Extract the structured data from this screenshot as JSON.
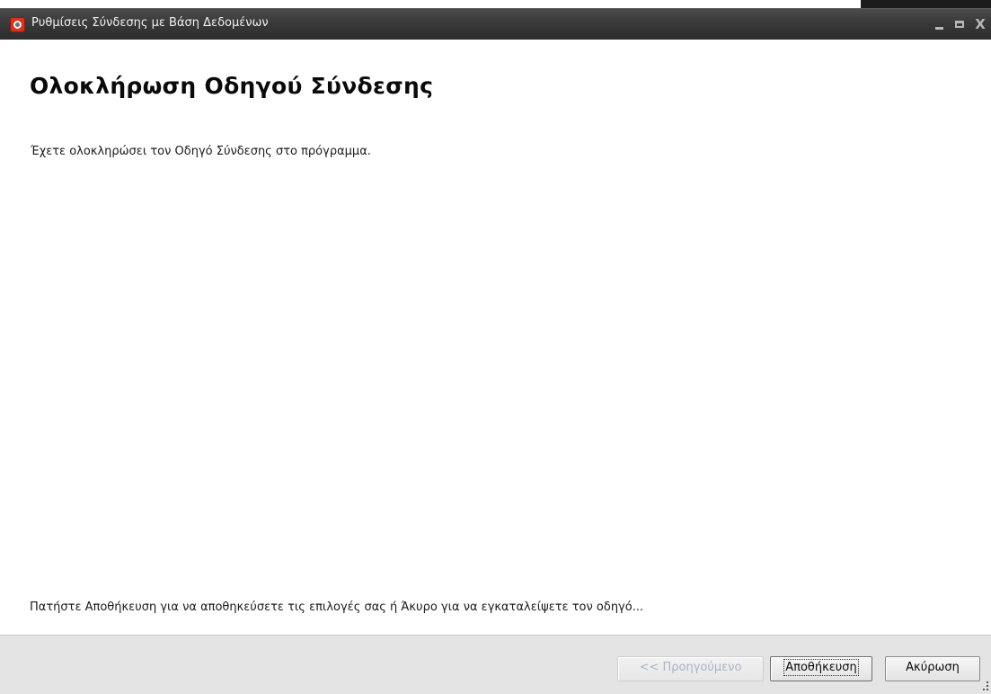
{
  "window": {
    "title": "Ρυθμίσεις Σύνδεσης με Βάση Δεδομένων",
    "icon": "app-database-icon",
    "controls": {
      "minimize": "minimize-icon",
      "maximize": "maximize-icon",
      "close_label": "X"
    }
  },
  "page": {
    "heading": "Ολοκλήρωση Οδηγού Σύνδεσης",
    "description": "Έχετε ολοκληρώσει τον Οδηγό Σύνδεσης στο πρόγραμμα.",
    "instruction": "Πατήστε Αποθήκευση για να αποθηκεύσετε τις επιλογές σας ή Άκυρο για να εγκαταλείψετε τον οδηγό..."
  },
  "footer": {
    "prev_label": "<< Προηγούμενο",
    "save_label": "Αποθήκευση",
    "cancel_label": "Ακύρωση"
  },
  "colors": {
    "titlebar": "#3a3a3a",
    "footer": "#e4e4e4",
    "disabled_text": "#a7b4c7"
  }
}
